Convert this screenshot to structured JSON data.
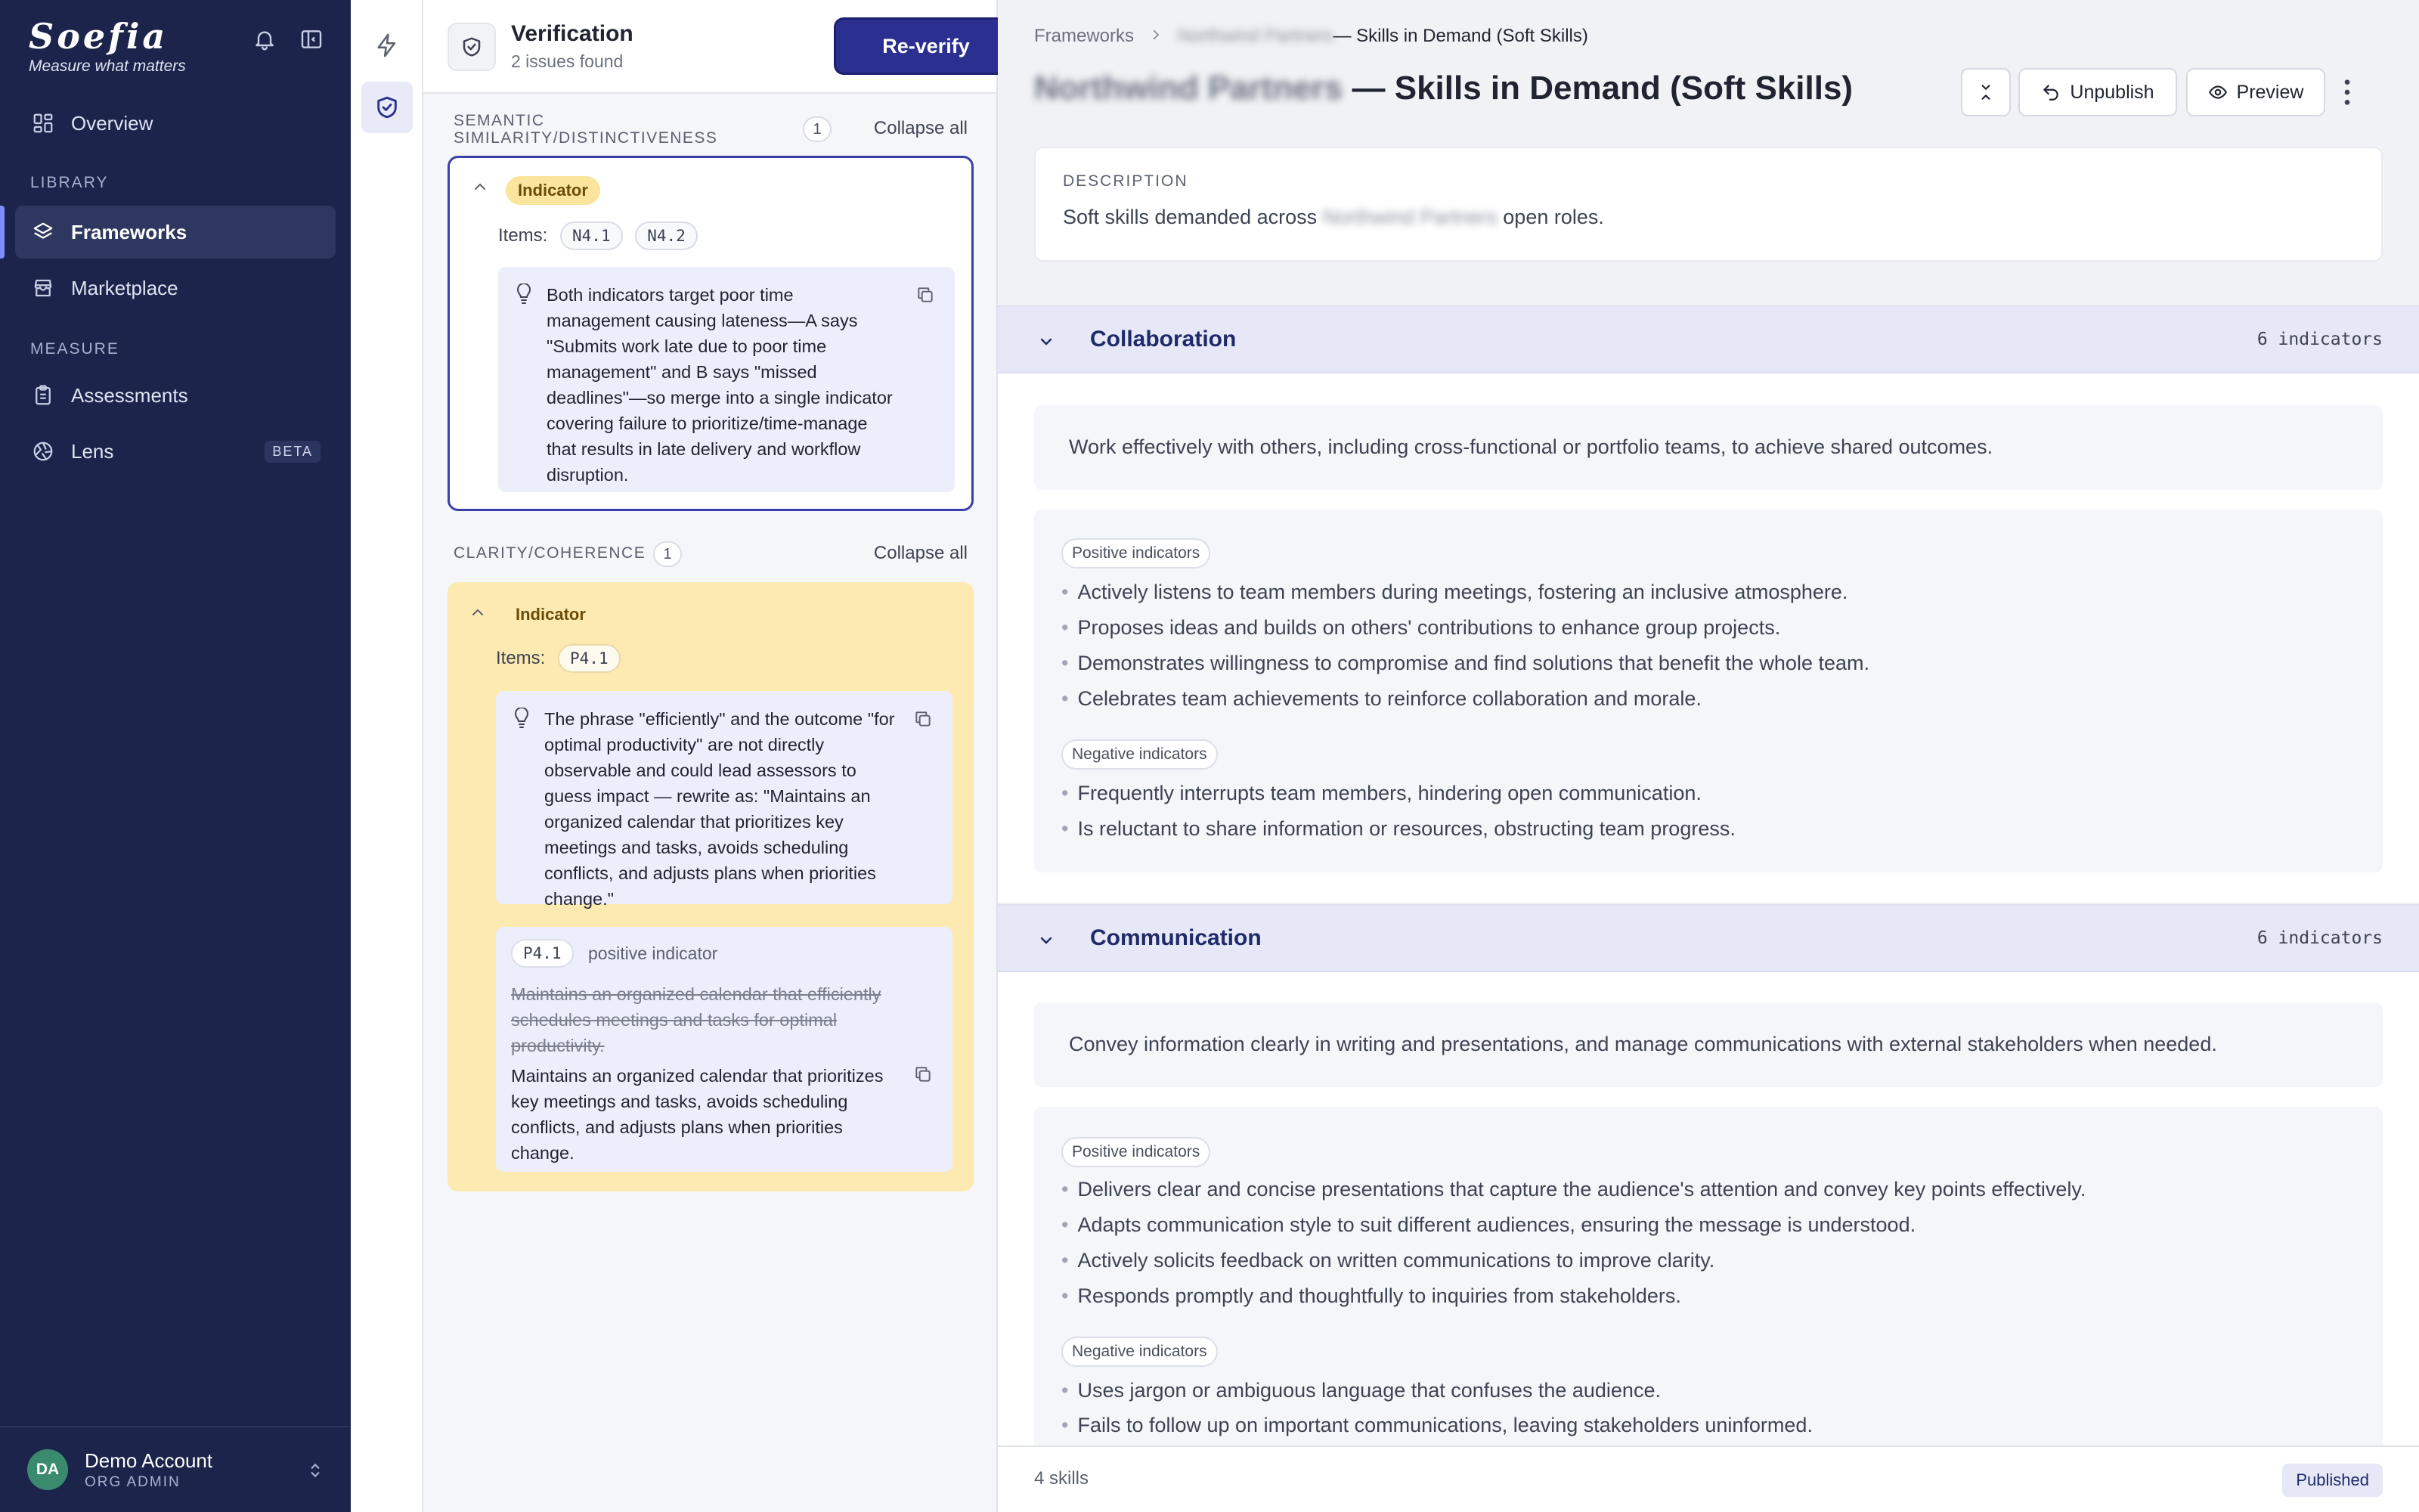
{
  "sidebar": {
    "logo": "Soefia",
    "tagline": "Measure what matters",
    "nav_overview": "Overview",
    "section_library": "LIBRARY",
    "nav_frameworks": "Frameworks",
    "nav_marketplace": "Marketplace",
    "section_measure": "MEASURE",
    "nav_assessments": "Assessments",
    "nav_lens": "Lens",
    "lens_badge": "BETA",
    "user_initials": "DA",
    "user_name": "Demo Account",
    "user_role": "ORG ADMIN"
  },
  "verification": {
    "title": "Verification",
    "subtitle": "2 issues found",
    "reverify_label": "Re-verify",
    "sections": [
      {
        "title": "SEMANTIC SIMILARITY/DISTINCTIVENESS",
        "count": "1",
        "collapse_label": "Collapse all",
        "issue": {
          "tag": "Indicator",
          "items_label": "Items:",
          "items": [
            "N4.1",
            "N4.2"
          ],
          "suggestion": "Both indicators target poor time management causing lateness—A says \"Submits work late due to poor time management\" and B says \"missed deadlines\"—so merge into a single indicator covering failure to prioritize/time-manage that results in late delivery and workflow disruption."
        }
      },
      {
        "title": "CLARITY/COHERENCE",
        "count": "1",
        "collapse_label": "Collapse all",
        "issue": {
          "tag": "Indicator",
          "items_label": "Items:",
          "items": [
            "P4.1"
          ],
          "suggestion": "The phrase \"efficiently\" and the outcome \"for optimal productivity\" are not directly observable and could lead assessors to guess impact — rewrite as: \"Maintains an organized calendar that prioritizes key meetings and tasks, avoids scheduling conflicts, and adjusts plans when priorities change.\"",
          "diff_item": "P4.1",
          "diff_kind": "positive indicator",
          "old_text": "Maintains an organized calendar that efficiently schedules meetings and tasks for optimal productivity.",
          "new_text": "Maintains an organized calendar that prioritizes key meetings and tasks, avoids scheduling conflicts, and adjusts plans when priorities change."
        }
      }
    ]
  },
  "main": {
    "breadcrumb_root": "Frameworks",
    "breadcrumb_org": "Northwind Partners",
    "breadcrumb_current": " — Skills in Demand (Soft Skills)",
    "title_org": "Northwind Partners",
    "title_rest": " — Skills in Demand (Soft Skills)",
    "unpublish_label": "Unpublish",
    "preview_label": "Preview",
    "description_label": "DESCRIPTION",
    "description_pre": "Soft skills demanded across ",
    "description_org": "Northwind Partners",
    "description_post": " open roles.",
    "skills": [
      {
        "name": "Collaboration",
        "count": "6 indicators",
        "description": "Work effectively with others, including cross-functional or portfolio teams, to achieve shared outcomes.",
        "positive_label": "Positive indicators",
        "positive": [
          "Actively listens to team members during meetings, fostering an inclusive atmosphere.",
          "Proposes ideas and builds on others' contributions to enhance group projects.",
          "Demonstrates willingness to compromise and find solutions that benefit the whole team.",
          "Celebrates team achievements to reinforce collaboration and morale."
        ],
        "negative_label": "Negative indicators",
        "negative": [
          "Frequently interrupts team members, hindering open communication.",
          "Is reluctant to share information or resources, obstructing team progress."
        ]
      },
      {
        "name": "Communication",
        "count": "6 indicators",
        "description": "Convey information clearly in writing and presentations, and manage communications with external stakeholders when needed.",
        "positive_label": "Positive indicators",
        "positive": [
          "Delivers clear and concise presentations that capture the audience's attention and convey key points effectively.",
          "Adapts communication style to suit different audiences, ensuring the message is understood.",
          "Actively solicits feedback on written communications to improve clarity.",
          "Responds promptly and thoughtfully to inquiries from stakeholders."
        ],
        "negative_label": "Negative indicators",
        "negative": [
          "Uses jargon or ambiguous language that confuses the audience.",
          "Fails to follow up on important communications, leaving stakeholders uninformed."
        ]
      }
    ],
    "footer_count": "4 skills",
    "status": "Published"
  }
}
